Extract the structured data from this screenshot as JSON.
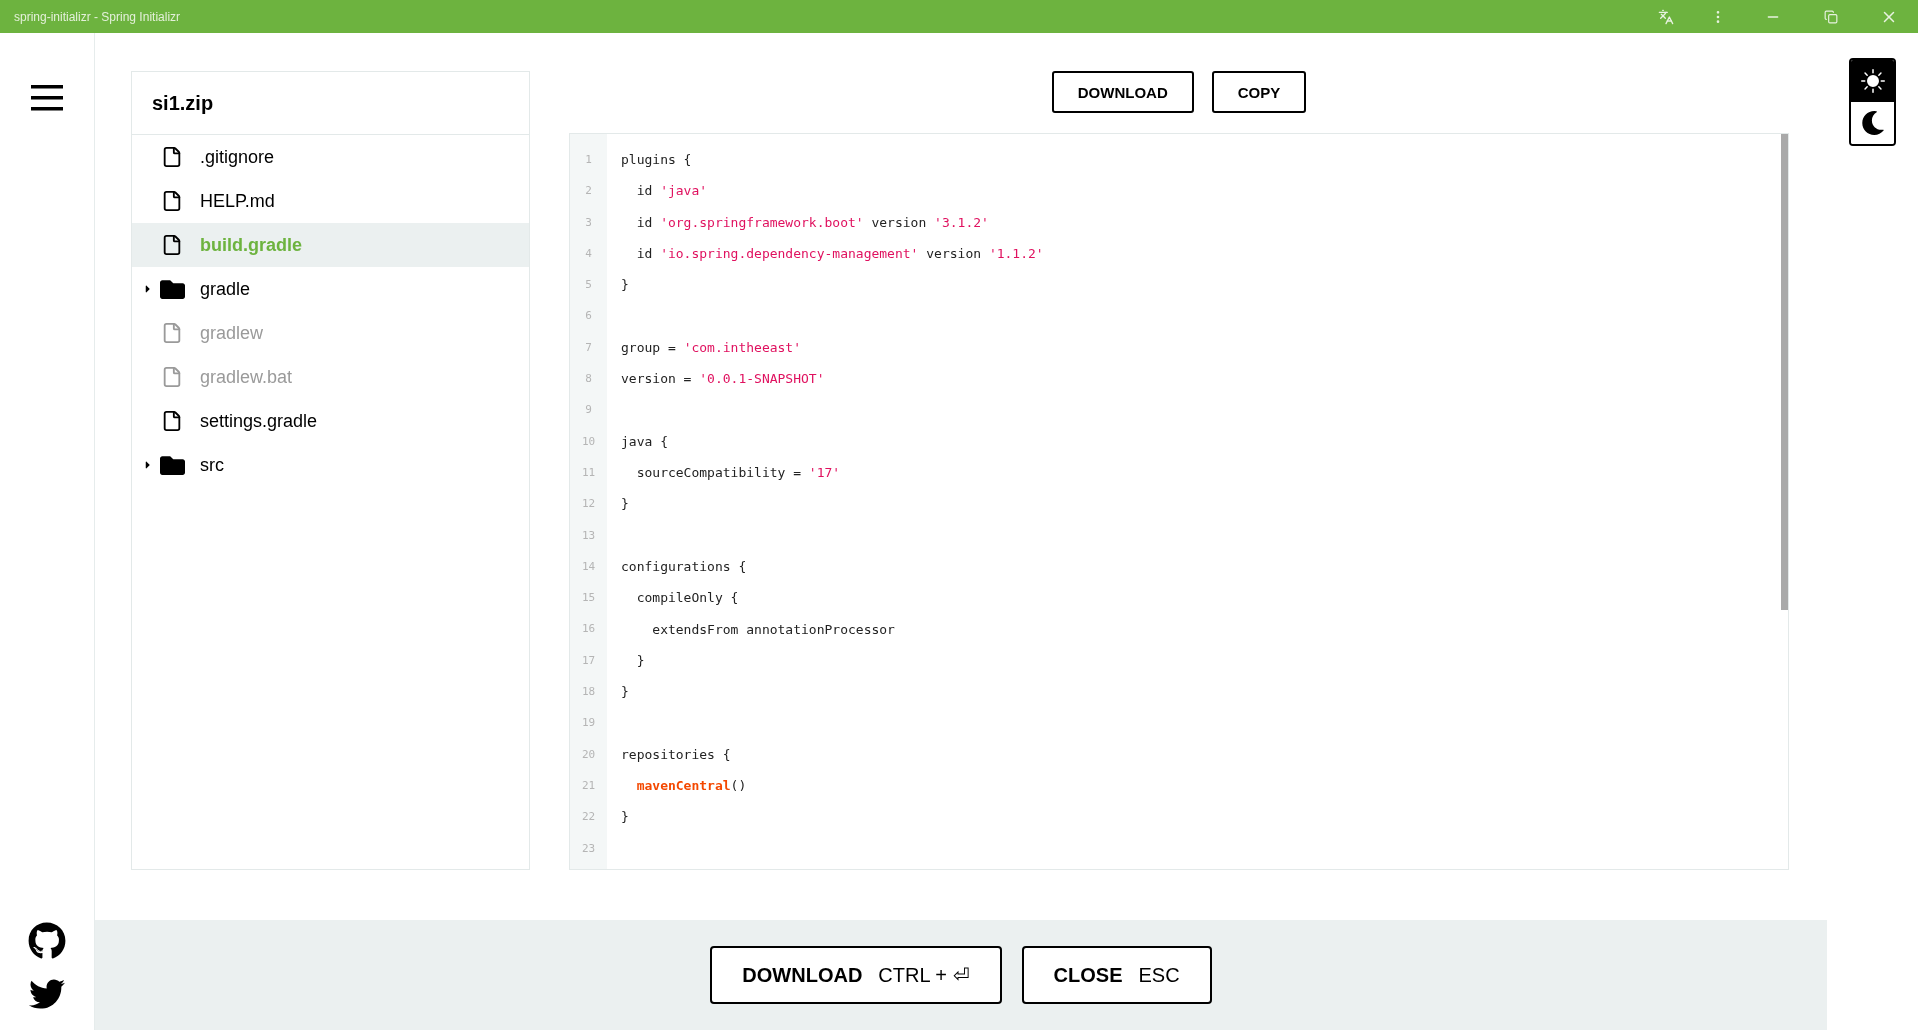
{
  "window": {
    "title": "spring-initializr - Spring Initializr"
  },
  "archive": {
    "name": "si1.zip"
  },
  "tree": [
    {
      "kind": "file",
      "name": ".gitignore",
      "selected": false,
      "disabled": false
    },
    {
      "kind": "file",
      "name": "HELP.md",
      "selected": false,
      "disabled": false
    },
    {
      "kind": "file",
      "name": "build.gradle",
      "selected": true,
      "disabled": false
    },
    {
      "kind": "folder",
      "name": "gradle",
      "selected": false,
      "disabled": false,
      "expanded": false
    },
    {
      "kind": "file",
      "name": "gradlew",
      "selected": false,
      "disabled": true
    },
    {
      "kind": "file",
      "name": "gradlew.bat",
      "selected": false,
      "disabled": true
    },
    {
      "kind": "file",
      "name": "settings.gradle",
      "selected": false,
      "disabled": false
    },
    {
      "kind": "folder",
      "name": "src",
      "selected": false,
      "disabled": false,
      "expanded": false
    }
  ],
  "toolbar": [
    "DOWNLOAD",
    "COPY"
  ],
  "code": [
    {
      "number": "1",
      "tokens": [
        {
          "kind": "plain",
          "text": "plugins {"
        }
      ]
    },
    {
      "number": "2",
      "tokens": [
        {
          "kind": "plain",
          "text": "  id "
        },
        {
          "kind": "string",
          "text": "'java'"
        }
      ]
    },
    {
      "number": "3",
      "tokens": [
        {
          "kind": "plain",
          "text": "  id "
        },
        {
          "kind": "string",
          "text": "'org.springframework.boot'"
        },
        {
          "kind": "plain",
          "text": " version "
        },
        {
          "kind": "string",
          "text": "'3.1.2'"
        }
      ]
    },
    {
      "number": "4",
      "tokens": [
        {
          "kind": "plain",
          "text": "  id "
        },
        {
          "kind": "string",
          "text": "'io.spring.dependency-management'"
        },
        {
          "kind": "plain",
          "text": " version "
        },
        {
          "kind": "string",
          "text": "'1.1.2'"
        }
      ]
    },
    {
      "number": "5",
      "tokens": [
        {
          "kind": "plain",
          "text": "}"
        }
      ]
    },
    {
      "number": "6"
    },
    {
      "number": "7",
      "tokens": [
        {
          "kind": "plain",
          "text": "group = "
        },
        {
          "kind": "string",
          "text": "'com.intheeast'"
        }
      ]
    },
    {
      "number": "8",
      "tokens": [
        {
          "kind": "plain",
          "text": "version = "
        },
        {
          "kind": "string",
          "text": "'0.0.1-SNAPSHOT'"
        }
      ]
    },
    {
      "number": "9"
    },
    {
      "number": "10",
      "tokens": [
        {
          "kind": "plain",
          "text": "java {"
        }
      ]
    },
    {
      "number": "11",
      "tokens": [
        {
          "kind": "plain",
          "text": "  sourceCompatibility = "
        },
        {
          "kind": "string",
          "text": "'17'"
        }
      ]
    },
    {
      "number": "12",
      "tokens": [
        {
          "kind": "plain",
          "text": "}"
        }
      ]
    },
    {
      "number": "13"
    },
    {
      "number": "14",
      "tokens": [
        {
          "kind": "plain",
          "text": "configurations {"
        }
      ]
    },
    {
      "number": "15",
      "tokens": [
        {
          "kind": "plain",
          "text": "  compileOnly {"
        }
      ]
    },
    {
      "number": "16",
      "tokens": [
        {
          "kind": "plain",
          "text": "    extendsFrom annotationProcessor"
        }
      ]
    },
    {
      "number": "17",
      "tokens": [
        {
          "kind": "plain",
          "text": "  }"
        }
      ]
    },
    {
      "number": "18",
      "tokens": [
        {
          "kind": "plain",
          "text": "}"
        }
      ]
    },
    {
      "number": "19"
    },
    {
      "number": "20",
      "tokens": [
        {
          "kind": "plain",
          "text": "repositories {"
        }
      ]
    },
    {
      "number": "21",
      "tokens": [
        {
          "kind": "function",
          "text": "  mavenCentral"
        },
        {
          "kind": "plain",
          "text": "()"
        }
      ]
    },
    {
      "number": "22",
      "tokens": [
        {
          "kind": "plain",
          "text": "}"
        }
      ]
    },
    {
      "number": "23"
    }
  ],
  "footer": [
    {
      "label": "DOWNLOAD",
      "shortcut": "CTRL + ⏎"
    },
    {
      "label": "CLOSE",
      "shortcut": "ESC"
    }
  ],
  "theme_modes": [
    {
      "kind": "light",
      "selected": true
    },
    {
      "kind": "dark",
      "selected": false
    }
  ]
}
